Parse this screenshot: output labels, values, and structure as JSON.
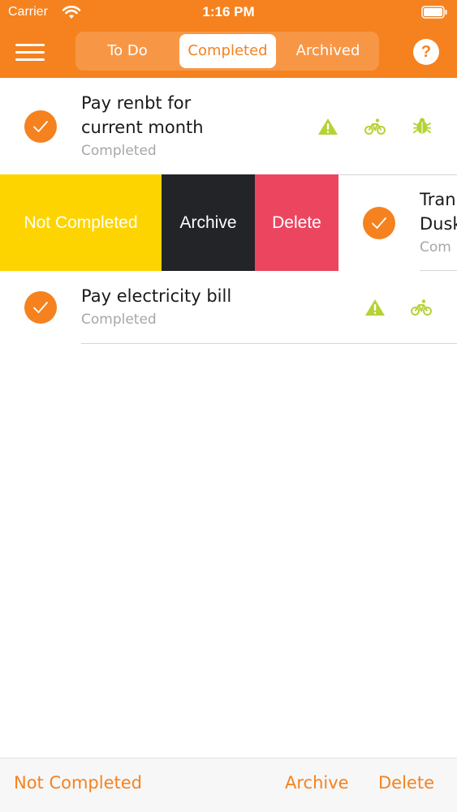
{
  "status_bar": {
    "carrier": "Carrier",
    "time": "1:16 PM"
  },
  "header": {
    "segments": [
      {
        "label": "To Do",
        "active": false
      },
      {
        "label": "Completed",
        "active": true
      },
      {
        "label": "Archived",
        "active": false
      }
    ],
    "help_label": "?"
  },
  "tasks": [
    {
      "title_line1": "Pay renbt for",
      "title_line2": "current month",
      "status": "Completed",
      "icons": [
        "warning-icon",
        "bicycle-icon",
        "bug-icon"
      ]
    },
    {
      "title_line1": "Tran",
      "title_line2": "Dusk",
      "status": "Com",
      "swipe_actions": [
        {
          "label": "Not Completed",
          "color": "#fed400"
        },
        {
          "label": "Archive",
          "color": "#232427"
        },
        {
          "label": "Delete",
          "color": "#ec4560"
        }
      ]
    },
    {
      "title": "Pay electricity bill",
      "status": "Completed",
      "icons": [
        "warning-icon",
        "bicycle-icon"
      ]
    }
  ],
  "toolbar": {
    "not_completed": "Not Completed",
    "archive": "Archive",
    "delete": "Delete"
  },
  "colors": {
    "accent": "#f5821f",
    "icon_green": "#b5d334"
  }
}
